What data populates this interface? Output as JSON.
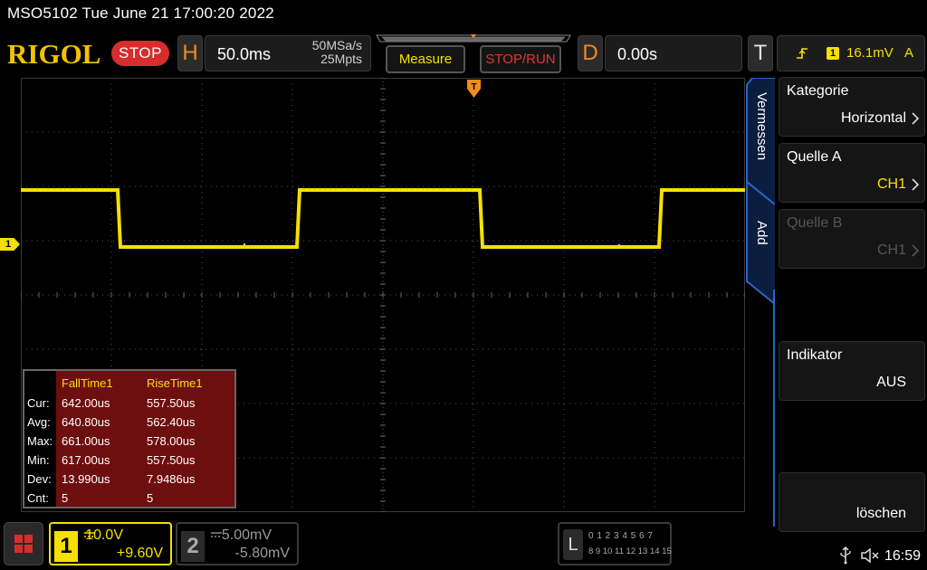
{
  "title_line": "MSO5102  Tue June 21 17:00:20 2022",
  "brand": "RIGOL",
  "run_state": "STOP",
  "horizontal": {
    "letter": "H",
    "timebase": "50.0ms",
    "sample_rate": "50MSa/s",
    "memory_depth": "25Mpts"
  },
  "buttons": {
    "measure": "Measure",
    "stop_run": "STOP/RUN"
  },
  "delay": {
    "letter": "D",
    "value": "0.00s"
  },
  "trigger": {
    "letter": "T",
    "source": "1",
    "level": "16.1mV",
    "mode": "A"
  },
  "channel_marker": "1",
  "measurement_table": {
    "columns": [
      "FallTime1",
      "RiseTime1"
    ],
    "rows": [
      {
        "label": "Cur:",
        "values": [
          "642.00us",
          "557.50us"
        ]
      },
      {
        "label": "Avg:",
        "values": [
          "640.80us",
          "562.40us"
        ]
      },
      {
        "label": "Max:",
        "values": [
          "661.00us",
          "578.00us"
        ]
      },
      {
        "label": "Min:",
        "values": [
          "617.00us",
          "557.50us"
        ]
      },
      {
        "label": "Dev:",
        "values": [
          "13.990us",
          "7.9486us"
        ]
      },
      {
        "label": "Cnt:",
        "values": [
          "5",
          "5"
        ]
      }
    ]
  },
  "side_menu": {
    "tabs": [
      "Vermessen",
      "Add"
    ],
    "items": [
      {
        "label": "Kategorie",
        "value": "Horizontal",
        "enabled": true
      },
      {
        "label": "Quelle A",
        "value": "CH1",
        "enabled": true
      },
      {
        "label": "Quelle B",
        "value": "CH1",
        "enabled": false
      },
      {
        "label": "Indikator",
        "value": "AUS",
        "enabled": true
      },
      {
        "label": "",
        "value": "löschen",
        "enabled": true
      }
    ]
  },
  "channels": [
    {
      "number": "1",
      "scale": "10.0V",
      "offset": "+9.60V",
      "color": "#f5e000",
      "active": true
    },
    {
      "number": "2",
      "scale": "5.00mV",
      "offset": "-5.80mV",
      "color": "#7a7a7a",
      "active": false
    }
  ],
  "logic_analyzer": {
    "letter": "L",
    "row1": "0 1 2 3  4 5 6 7",
    "row2": "8  9 10 11 12 13 14 15"
  },
  "status_bar": {
    "time": "16:59",
    "icons": [
      "usb-icon",
      "speaker-muted-icon"
    ]
  },
  "colors": {
    "ch1": "#f5e000",
    "accent_orange": "#f08c1c",
    "menu_blue": "#1a4fa8",
    "stop_red": "#d72d2d"
  }
}
